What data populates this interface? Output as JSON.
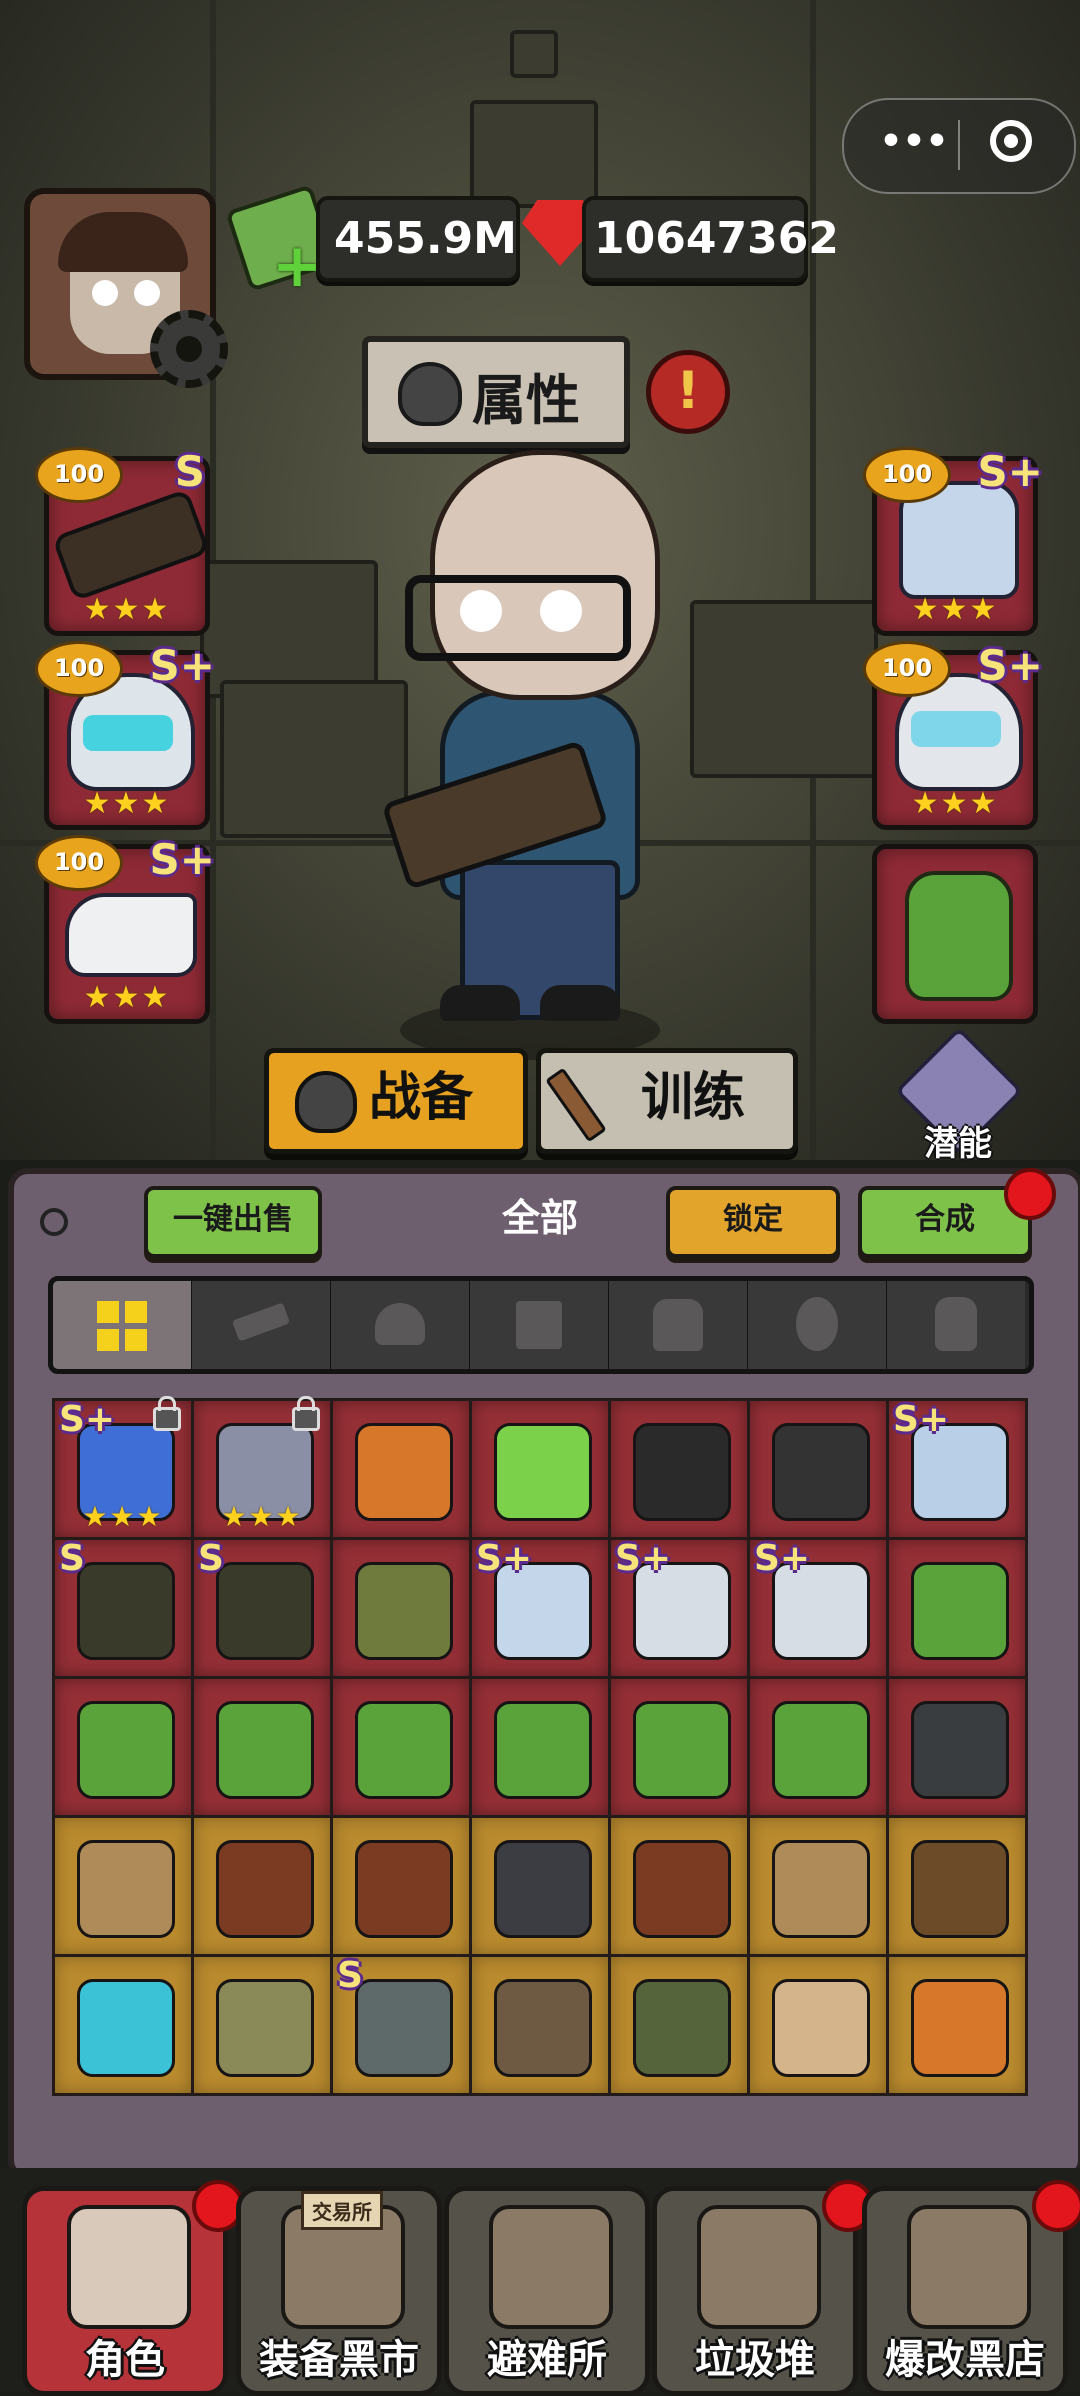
{
  "currency": {
    "cash": "455.9M",
    "gems": "10647362"
  },
  "header": {
    "attributes_label": "属性",
    "alert": "!"
  },
  "left_slots": [
    {
      "level": "100",
      "grade": "S",
      "stars": "★★★",
      "icon": "minigun-icon"
    },
    {
      "level": "100",
      "grade": "S+",
      "stars": "★★★",
      "icon": "helmet-icon"
    },
    {
      "level": "100",
      "grade": "S+",
      "stars": "★★★",
      "icon": "sneaker-icon"
    }
  ],
  "right_slots": [
    {
      "level": "100",
      "grade": "S+",
      "stars": "★★★",
      "icon": "armor-icon"
    },
    {
      "level": "100",
      "grade": "S+",
      "stars": "★★★",
      "icon": "visor-helmet-icon"
    },
    {
      "level": "",
      "grade": "",
      "stars": "",
      "icon": "backpack-icon"
    }
  ],
  "tabs": {
    "equipment": "战备",
    "training": "训练",
    "potential": "潜能"
  },
  "panel": {
    "quick_sell": "一键出售",
    "filter_title": "全部",
    "lock": "锁定",
    "merge": "合成",
    "categories": [
      "grid-icon",
      "gun-icon",
      "helmet-icon",
      "pants-icon",
      "armor-icon",
      "mask-icon",
      "backpack-icon"
    ]
  },
  "inventory": [
    [
      {
        "grade": "S+",
        "stars": "★★★",
        "lock": true,
        "color": "#3f6fd6",
        "icon": "rifle-icon"
      },
      {
        "grade": "",
        "stars": "★★★",
        "lock": true,
        "color": "#8a8fa6",
        "icon": "launcher-icon"
      },
      {
        "grade": "",
        "stars": "",
        "lock": false,
        "color": "#d6772a",
        "icon": "helmet-icon"
      },
      {
        "grade": "",
        "stars": "",
        "lock": false,
        "color": "#7bd14a",
        "icon": "shoe-icon"
      },
      {
        "grade": "",
        "stars": "",
        "lock": false,
        "color": "#2a2a2a",
        "icon": "boot-icon"
      },
      {
        "grade": "",
        "stars": "",
        "lock": false,
        "color": "#333333",
        "icon": "boot-icon"
      },
      {
        "grade": "S+",
        "stars": "",
        "lock": false,
        "color": "#b9cfe8",
        "icon": "armor-icon"
      }
    ],
    [
      {
        "grade": "S",
        "stars": "",
        "lock": false,
        "color": "#3a3a2a",
        "icon": "armor-icon"
      },
      {
        "grade": "S",
        "stars": "",
        "lock": false,
        "color": "#3a3a2a",
        "icon": "armor-icon"
      },
      {
        "grade": "",
        "stars": "",
        "lock": false,
        "color": "#6f7a3d",
        "icon": "vest-icon"
      },
      {
        "grade": "S+",
        "stars": "",
        "lock": false,
        "color": "#c3d6ea",
        "icon": "armor-icon"
      },
      {
        "grade": "S+",
        "stars": "",
        "lock": false,
        "color": "#d6dde4",
        "icon": "visor-helmet-icon"
      },
      {
        "grade": "S+",
        "stars": "",
        "lock": false,
        "color": "#d6dde4",
        "icon": "visor-helmet-icon"
      },
      {
        "grade": "",
        "stars": "",
        "lock": false,
        "color": "#5aa33a",
        "icon": "backpack-icon"
      }
    ],
    [
      {
        "grade": "",
        "stars": "",
        "lock": false,
        "color": "#5aa33a",
        "icon": "backpack-icon"
      },
      {
        "grade": "",
        "stars": "",
        "lock": false,
        "color": "#5aa33a",
        "icon": "backpack-icon"
      },
      {
        "grade": "",
        "stars": "",
        "lock": false,
        "color": "#5aa33a",
        "icon": "backpack-icon"
      },
      {
        "grade": "",
        "stars": "",
        "lock": false,
        "color": "#5aa33a",
        "icon": "backpack-icon"
      },
      {
        "grade": "",
        "stars": "",
        "lock": false,
        "color": "#5aa33a",
        "icon": "backpack-icon"
      },
      {
        "grade": "",
        "stars": "",
        "lock": false,
        "color": "#5aa33a",
        "icon": "backpack-icon"
      },
      {
        "grade": "",
        "stars": "",
        "lock": false,
        "color": "#3a3d3f",
        "icon": "battery-pack-icon"
      }
    ],
    [
      {
        "grade": "",
        "stars": "",
        "lock": false,
        "color": "#b08b5a",
        "icon": "rifle-icon"
      },
      {
        "grade": "",
        "stars": "",
        "lock": false,
        "color": "#7b3b22",
        "icon": "ak-icon"
      },
      {
        "grade": "",
        "stars": "",
        "lock": false,
        "color": "#7b3b22",
        "icon": "ak-icon"
      },
      {
        "grade": "",
        "stars": "",
        "lock": false,
        "color": "#3b3d42",
        "icon": "smg-icon"
      },
      {
        "grade": "",
        "stars": "",
        "lock": false,
        "color": "#7b3b22",
        "icon": "ak-icon"
      },
      {
        "grade": "",
        "stars": "",
        "lock": false,
        "color": "#b08b5a",
        "icon": "rifle-icon"
      },
      {
        "grade": "",
        "stars": "",
        "lock": false,
        "color": "#6b4b28",
        "icon": "sniper-icon"
      }
    ],
    [
      {
        "grade": "",
        "stars": "",
        "lock": false,
        "color": "#3bc2d6",
        "icon": "launcher-icon"
      },
      {
        "grade": "",
        "stars": "",
        "lock": false,
        "color": "#8a8a58",
        "icon": "helmet-icon"
      },
      {
        "grade": "S",
        "stars": "",
        "lock": false,
        "color": "#5e6a6a",
        "icon": "helmet-icon"
      },
      {
        "grade": "",
        "stars": "",
        "lock": false,
        "color": "#6e5a42",
        "icon": "helmet-icon"
      },
      {
        "grade": "",
        "stars": "",
        "lock": false,
        "color": "#55643a",
        "icon": "helmet-icon"
      },
      {
        "grade": "",
        "stars": "",
        "lock": false,
        "color": "#d4b48a",
        "icon": "helmet-icon"
      },
      {
        "grade": "",
        "stars": "",
        "lock": false,
        "color": "#d6772a",
        "icon": "helmet-icon"
      }
    ]
  ],
  "nav": [
    {
      "label": "角色",
      "active": true,
      "dot": true,
      "icon": "character-icon"
    },
    {
      "label": "装备黑市",
      "active": false,
      "dot": false,
      "icon": "market-icon",
      "sign": "交易所"
    },
    {
      "label": "避难所",
      "active": false,
      "dot": false,
      "icon": "shelter-icon"
    },
    {
      "label": "垃圾堆",
      "active": false,
      "dot": true,
      "icon": "trash-pile-icon"
    },
    {
      "label": "爆改黑店",
      "active": false,
      "dot": true,
      "icon": "mod-shop-icon"
    }
  ]
}
